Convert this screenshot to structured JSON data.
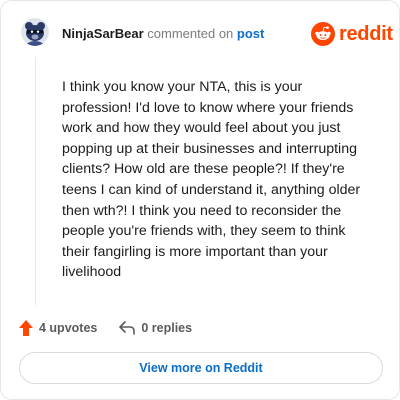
{
  "header": {
    "username": "NinjaSarBear",
    "action_text": "commented on",
    "target_link": "post",
    "brand_name": "reddit"
  },
  "comment": {
    "lines": [
      "I think you know your NTA, this is your",
      "profession! I'd love to know where your friends",
      "work and how they would feel about you just",
      "popping up at their businesses and interrupting",
      "clients? How old are these people?! If they're",
      "teens I can kind of understand it, anything older",
      "then wth?! I think you need to reconsider the",
      "people you're friends with, they seem to think",
      "their fangirling is more important than your",
      "livelihood"
    ]
  },
  "actions": {
    "upvotes_label": "4 upvotes",
    "replies_label": "0 replies"
  },
  "footer": {
    "view_more_label": "View more on Reddit"
  },
  "colors": {
    "brand": "#ff4500",
    "link": "#0a6ecb",
    "muted": "#7c7c7c"
  },
  "icons": {
    "avatar": "bear-avatar-icon",
    "brand": "reddit-snoo-icon",
    "upvote": "upvote-arrow-icon",
    "reply": "reply-arrow-icon"
  }
}
